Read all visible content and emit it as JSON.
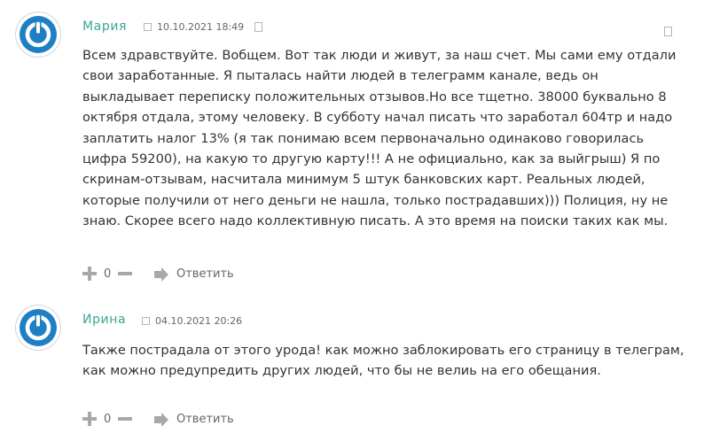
{
  "comments": [
    {
      "author": "Мария",
      "date": "10.10.2021 18:49",
      "text": "Всем здравствуйте. Вобщем. Вот так люди и живут, за наш счет. Мы сами ему отдали свои заработанные. Я пыталась найти людей в телеграмм канале, ведь он выкладывает переписку положительных отзывов.Но все тщетно. 38000 буквально 8 октября отдала, этому человеку. В субботу начал писать что заработал 604тр и надо заплатить налог 13% (я так понимаю всем первоначально одинаково говорилась цифра 59200), на какую то другую карту!!! А не официально, как за выйгрыш) Я по скринам-отзывам, насчитала минимум 5 штук банковских карт. Реальных людей, которые получили от него деньги не нашла, только пострадавших))) Полиция, ну не знаю. Скорее всего надо коллективную писать. А это время на поиски таких как мы.",
      "votes": "0",
      "reply": "Ответить"
    },
    {
      "author": "Ирина",
      "date": "04.10.2021 20:26",
      "text": "Также пострадала от этого урода! как можно заблокировать его страницу в телеграм, как можно предупредить других людей, что бы не велиь на его обещания.",
      "votes": "0",
      "reply": "Ответить"
    }
  ],
  "colors": {
    "author": "#3aa694",
    "avatar": "#1e7fc4",
    "icons": "#a8a8a8",
    "text": "#333333"
  },
  "icons": [
    "avatar-power-icon",
    "plus-icon",
    "minus-icon",
    "reply-arrow-icon",
    "checkbox-icon"
  ]
}
